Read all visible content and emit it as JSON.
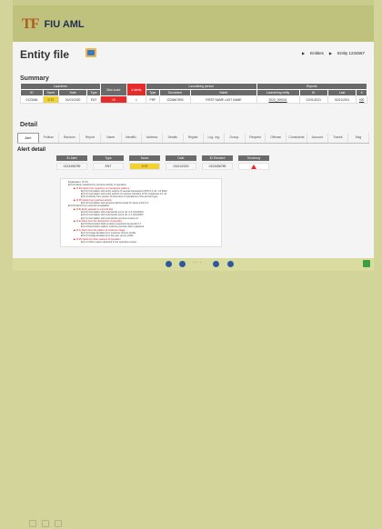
{
  "app": {
    "logo_mark_a": "T",
    "logo_mark_b": "F",
    "name": "FIU AML"
  },
  "page": {
    "title": "Entity file",
    "crumbs": [
      "Entities",
      "Entity 1234567"
    ]
  },
  "summary": {
    "heading": "Summary",
    "group_headers": [
      "Launderer",
      "Max score",
      "# alerts",
      "Laundering person",
      "Reports"
    ],
    "col_headers": [
      "ID",
      "Score",
      "Date",
      "Type",
      "Max score",
      "# alerts",
      "Type",
      "Document",
      "Name",
      "Laundering entity",
      "ID",
      "Last",
      "#"
    ],
    "row": [
      "0123456",
      "0.72",
      "01/01/2020",
      "ENT",
      "15",
      "1",
      "PRF",
      "1234567890",
      "FIRST NAME LAST NAME",
      "2020_000001",
      "01/01/2021",
      "01/01/2021",
      "000"
    ]
  },
  "detail": {
    "heading": "Detail",
    "tabs": [
      "Alert",
      "Politum",
      "Random",
      "Report",
      "Name",
      "Identific.",
      "Address",
      "Details",
      "Registr.",
      "Log. org.",
      "Occup.",
      "Request",
      "Offense",
      "Constraints",
      "Account",
      "Transit",
      "Msg"
    ]
  },
  "alert": {
    "label": "Alert detail",
    "headers": [
      "ID Alert",
      "Type",
      "Score",
      "Date",
      "ID Element",
      "Tendency"
    ],
    "values": [
      "0123456789",
      "ENT",
      "0.72",
      "01/01/2020",
      "0123456789",
      ""
    ]
  },
  "tree": [
    {
      "lvl": 1,
      "text": "Explanation: (0.72)"
    },
    {
      "lvl": 1,
      "text": "■ (0.9) Alerts sustained by previous activity of operation"
    },
    {
      "lvl": 2,
      "text": "▶ (0.60) Alerts from suspicion on transaction patterns"
    },
    {
      "lvl": 3,
      "text": "■ (0.6) Correlation with entity activity of several transactions [INT] 0.3 ref. 1.5.2020"
    },
    {
      "lvl": 3,
      "text": "■ (0.2) Correlation with entity activity of previous transfers of the suspicious 0.1 ref."
    },
    {
      "lvl": 3,
      "text": "■ (0.2) Activity from person of document of operations of the account type"
    },
    {
      "lvl": 2,
      "text": "▶ (0.45) Alerts from previous activity"
    },
    {
      "lvl": 3,
      "text": "■ (0.4) Correlation with previous alerts issued for same entity 0.2"
    },
    {
      "lvl": 1,
      "text": "■ (0.8) Alerts from external consultation"
    },
    {
      "lvl": 2,
      "text": "▶ (0.8) Entity appears in external lists"
    },
    {
      "lvl": 3,
      "text": "■ (0.6) Correlation with external list score ref. 0.3 (1/1/2020)"
    },
    {
      "lvl": 3,
      "text": "■ (0.2) Correlation with external list score ref. 0.1 (1/1/2020)"
    },
    {
      "lvl": 3,
      "text": "■ (0.1) Correlation with external list previous review ref."
    },
    {
      "lvl": 2,
      "text": "▶ (0.2) Alerts from the description of operation"
    },
    {
      "lvl": 3,
      "text": "■ (0.5) Description field contains suspicious keywords 0.1"
    },
    {
      "lvl": 3,
      "text": "■ (0.4) Description pattern matches previous alert registered"
    },
    {
      "lvl": 2,
      "text": "▶ (0.1) Alerts from the pattern of customer usage"
    },
    {
      "lvl": 3,
      "text": "■ (0.3) Usage deviates from customer historic profile"
    },
    {
      "lvl": 3,
      "text": "■ (0.2) Usage deviates from the peer group profile"
    },
    {
      "lvl": 2,
      "text": "▶ (0.05) Alerts for other reasons of operation"
    },
    {
      "lvl": 3,
      "text": "■ (0.1) Other reason detected in the operation review"
    }
  ],
  "toolbar": {
    "dots": "· · ·"
  },
  "colors": {
    "header": "#bfc27d",
    "accent_red": "#e62b2b",
    "accent_yellow": "#f2d233",
    "table_header": "#6a6a6a"
  }
}
